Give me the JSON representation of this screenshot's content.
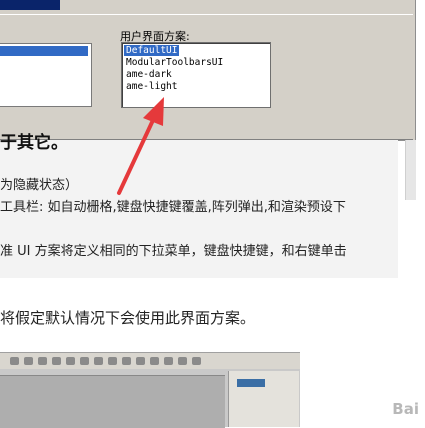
{
  "dialog": {
    "scheme_label": "用户界面方案:",
    "schemes": [
      "DefaultUI",
      "ModularToolbarsUI",
      "ame-dark",
      "ame-light"
    ],
    "selected_scheme": "DefaultUI"
  },
  "article": {
    "heading_fragment": "于其它。",
    "lines": [
      "为隐藏状态）",
      "工具栏: 如自动栅格,键盘快捷键覆盖,阵列弹出,和渲染预设下",
      "准 UI 方案将定义相同的下拉菜单，键盘快捷键，和右键单击"
    ],
    "body": "将假定默认情况下会使用此界面方案。"
  },
  "colors": {
    "arrow": "#e5393b",
    "selection": "#316ac5"
  },
  "watermark": "Bai"
}
